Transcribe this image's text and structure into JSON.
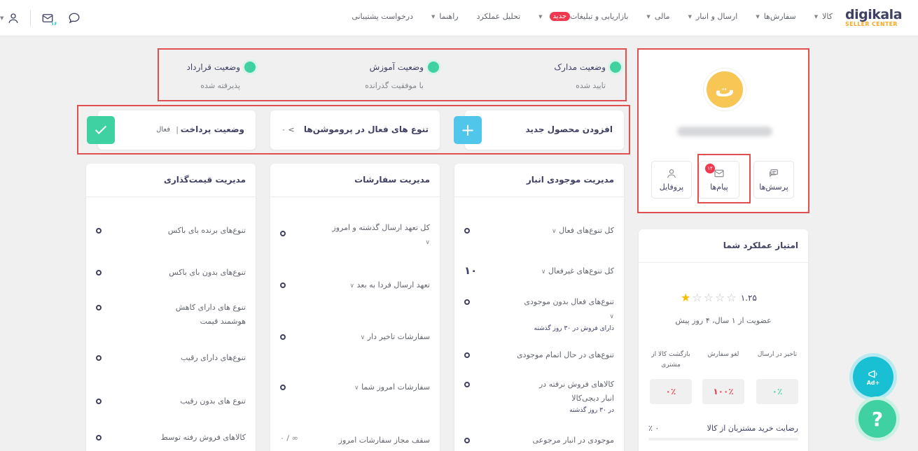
{
  "logo": {
    "name": "digikala",
    "sub": "SELLER CENTER"
  },
  "nav": [
    {
      "label": "کالا",
      "caret": true
    },
    {
      "label": "سفارش‌ها",
      "caret": true
    },
    {
      "label": "ارسال و انبار",
      "caret": true
    },
    {
      "label": "مالی",
      "caret": true
    },
    {
      "label": "بازاریابی و تبلیغات",
      "badge": "جدید",
      "caret": true
    },
    {
      "label": "تحلیل عملکرد",
      "caret": false
    },
    {
      "label": "راهنما",
      "caret": true
    },
    {
      "label": "درخواست پشتیبانی",
      "caret": false
    }
  ],
  "top_icons": {
    "messages_count": "۱۶"
  },
  "profile": {
    "avatar_letter": "ت",
    "buttons": {
      "questions": "پرسش‌ها",
      "messages": "پیام‌ها",
      "profile": "پروفایل"
    },
    "messages_badge": "۱۴"
  },
  "statuses": [
    {
      "title": "وضعیت مدارک",
      "value": "تایید شده"
    },
    {
      "title": "وضعیت آموزش",
      "value": "با موفقیت گذرانده"
    },
    {
      "title": "وضعیت قرارداد",
      "value": "پذیرفته شده"
    }
  ],
  "tiles": {
    "add_product": "افزودن محصول جدید",
    "promo_variants": "تنوع های فعال در پروموشن‌ها",
    "promo_value": "۰ <",
    "payment_status": "وضعیت پرداخت",
    "payment_sep": "|",
    "payment_value": "فعال"
  },
  "columns": {
    "inventory": {
      "title": "مدیریت موجودی انبار",
      "rows": [
        {
          "label": "کل تنوع‌های فعال",
          "chevron": "∨",
          "value": "۰"
        },
        {
          "label": "کل تنوع‌های غیرفعال",
          "chevron": "∨",
          "value": "۱۰"
        },
        {
          "label": "تنوع‌های فعال بدون موجودی",
          "chevron": "∨",
          "sub": "دارای فروش در ۳۰ روز گذشته",
          "value": "۰"
        },
        {
          "label": "تنوع‌های در حال اتمام موجودی",
          "value": "۰"
        },
        {
          "label": "کالاهای فروش نرفته در انبار دیجی‌کالا",
          "sub": "در ۳۰ روز گذشته",
          "value": "۰"
        },
        {
          "label": "موجودی در انبار مرجوعی",
          "value": "۰"
        }
      ]
    },
    "orders": {
      "title": "مدیریت سفارشات",
      "rows": [
        {
          "label": "کل تعهد ارسال گذشته و امروز",
          "chevron": "∨",
          "value": "۰"
        },
        {
          "label": "تعهد ارسال فردا به بعد",
          "chevron": "∨",
          "value": "۰"
        },
        {
          "label": "سفارشات تاخیر دار",
          "chevron": "∨",
          "value": "۰"
        },
        {
          "label": "سفارشات امروز شما",
          "chevron": "∨",
          "value": "۰"
        },
        {
          "label": "سقف مجاز سفارشات امروز",
          "value": "۰ / ∞"
        }
      ]
    },
    "pricing": {
      "title": "مدیریت قیمت‌گذاری",
      "rows": [
        {
          "label": "تنوع‌های برنده بای باکس",
          "value": "۰"
        },
        {
          "label": "تنوع‌های بدون بای باکس",
          "value": "۰"
        },
        {
          "label": "تنوع های دارای کاهش هوشمند قیمت",
          "value": "۰"
        },
        {
          "label": "تنوع‌های دارای رقیب",
          "value": "۰"
        },
        {
          "label": "تنوع های بدون رقیب",
          "value": "۰"
        },
        {
          "label": "کالاهای فروش رفته توسط",
          "value": "۰"
        }
      ]
    }
  },
  "score": {
    "title": "امتیاز عملکرد شما",
    "rating": "۱.۲۵",
    "stars_filled": 1,
    "stars_total": 5,
    "member_since": "عضویت از ۱ سال، ۴ روز پیش",
    "metrics": [
      {
        "label": "تاخیر در ارسال",
        "value": "۰٪",
        "color": "#3fd1a1"
      },
      {
        "label": "لغو سفارش",
        "value": "۱۰۰٪",
        "color": "#ef394e"
      },
      {
        "label": "بازگشت کالا از مشتری",
        "value": "۰٪",
        "color": "#ef394e"
      }
    ],
    "satisfaction_label": "رضایت خرید مشتریان از کالا",
    "satisfaction_value": "۰ ٪"
  },
  "fab": {
    "ad_label": "+Ad",
    "help_label": "?"
  }
}
